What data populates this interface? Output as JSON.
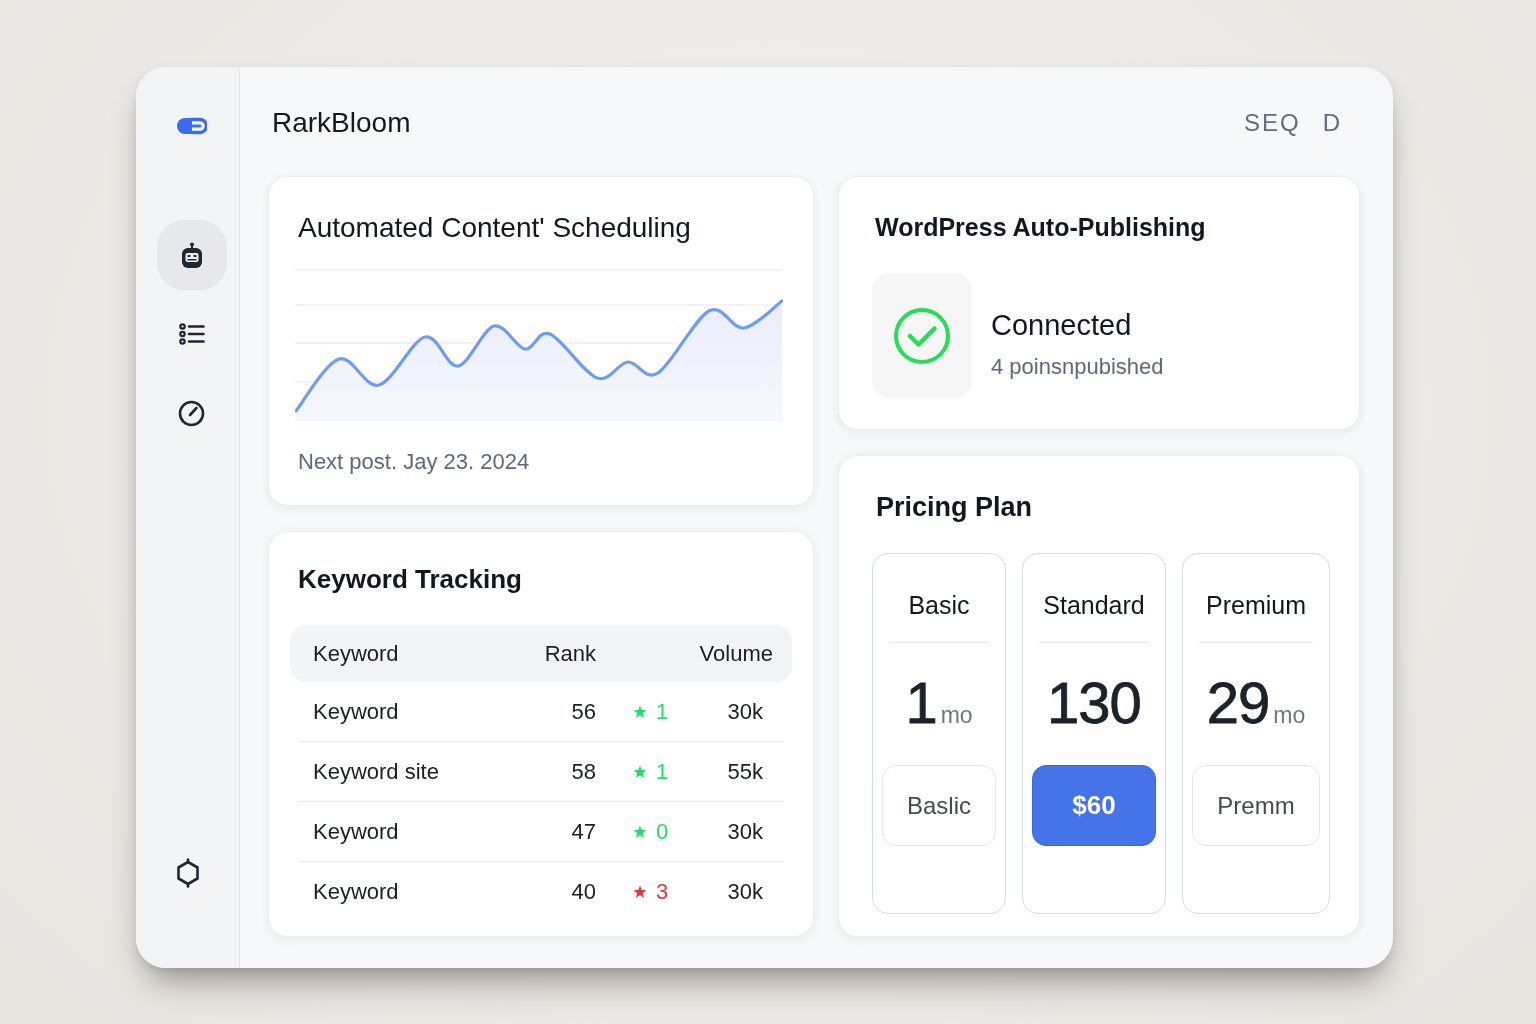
{
  "header": {
    "title": "RarkBloom",
    "labels": [
      "SEQ",
      "D"
    ]
  },
  "sidebar": {
    "items": [
      {
        "selected": true
      },
      {
        "selected": false
      },
      {
        "selected": false
      }
    ]
  },
  "scheduling": {
    "title": "Automated Content' Scheduling",
    "next_post": "Next post. Jay 23. 2024"
  },
  "publishing": {
    "title": "WordPress Auto-Publishing",
    "status": "Connected",
    "detail": "4 poinsnpubished"
  },
  "keywords": {
    "title": "Keyword Tracking",
    "columns": [
      "Keyword",
      "Rank",
      "Volume"
    ],
    "rows": [
      {
        "keyword": "Keyword",
        "rank": "56",
        "color": "#22dd6a",
        "change": "1",
        "volume": "30k"
      },
      {
        "keyword": "Keyword site",
        "rank": "58",
        "color": "#22dd6a",
        "change": "1",
        "volume": "55k"
      },
      {
        "keyword": "Keyword",
        "rank": "47",
        "color": "#22dd6a",
        "change": "0",
        "volume": "30k"
      },
      {
        "keyword": "Keyword",
        "rank": "40",
        "color": "#e5343d",
        "change": "3",
        "volume": "30k"
      }
    ]
  },
  "pricing": {
    "title": "Pricing Plan",
    "plans": [
      {
        "name": "Basic",
        "price": "1",
        "unit": "mo",
        "button": "Baslic",
        "selected": false
      },
      {
        "name": "Standard",
        "price": "130",
        "button": "$60",
        "selected": true
      },
      {
        "name": "Premium",
        "price": "29",
        "unit": "mo",
        "button": "Premm",
        "selected": false
      }
    ]
  }
}
